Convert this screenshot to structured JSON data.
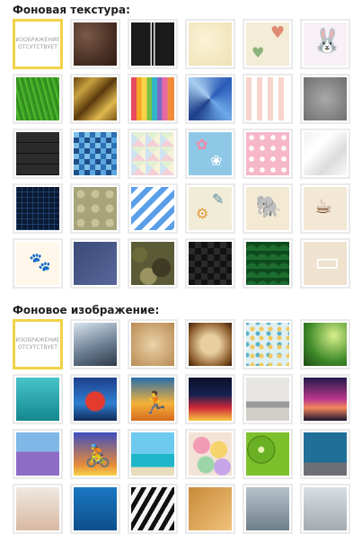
{
  "texture_section": {
    "title": "Фоновая текстура:",
    "tiles": [
      {
        "name": "no-image",
        "placeholder": "ИЗОБРАЖЕНИЕ ОТСУТСТВУЕТ",
        "selected": true
      },
      {
        "name": "leather-brown"
      },
      {
        "name": "black-road"
      },
      {
        "name": "cream-paper"
      },
      {
        "name": "hearts-pattern"
      },
      {
        "name": "bunny"
      },
      {
        "name": "green-grass"
      },
      {
        "name": "gold-foil"
      },
      {
        "name": "rainbow-stripes"
      },
      {
        "name": "blue-triangles"
      },
      {
        "name": "pink-stripes"
      },
      {
        "name": "gray-concrete"
      },
      {
        "name": "black-planks"
      },
      {
        "name": "blue-mosaic"
      },
      {
        "name": "pastel-rhombs"
      },
      {
        "name": "blue-doodles"
      },
      {
        "name": "pink-polka"
      },
      {
        "name": "white-crumpled"
      },
      {
        "name": "dark-blue-plaid"
      },
      {
        "name": "olive-dots"
      },
      {
        "name": "blue-diagonal-stripes"
      },
      {
        "name": "tools-pattern"
      },
      {
        "name": "elephants-pattern"
      },
      {
        "name": "kitchen-pattern"
      },
      {
        "name": "paw-tiles"
      },
      {
        "name": "denim-patch"
      },
      {
        "name": "camouflage"
      },
      {
        "name": "black-weave"
      },
      {
        "name": "green-scales"
      },
      {
        "name": "beige-furniture"
      }
    ]
  },
  "image_section": {
    "title": "Фоновое изображение:",
    "tiles": [
      {
        "name": "no-image",
        "placeholder": "ИЗОБРАЖЕНИЕ ОТСУТСТВУЕТ",
        "selected": true
      },
      {
        "name": "skyscraper"
      },
      {
        "name": "old-paper"
      },
      {
        "name": "burnt-parchment"
      },
      {
        "name": "confetti"
      },
      {
        "name": "christmas-tree"
      },
      {
        "name": "turquoise-water"
      },
      {
        "name": "race-car"
      },
      {
        "name": "runners-sunset"
      },
      {
        "name": "city-light-trails"
      },
      {
        "name": "living-room"
      },
      {
        "name": "purple-sunset-coast"
      },
      {
        "name": "lavender-field"
      },
      {
        "name": "cyclist-silhouette"
      },
      {
        "name": "tropical-sea"
      },
      {
        "name": "macarons"
      },
      {
        "name": "kiwi-slices"
      },
      {
        "name": "blue-wall-wood"
      },
      {
        "name": "portrait"
      },
      {
        "name": "ocean-wave"
      },
      {
        "name": "zebra"
      },
      {
        "name": "gold-hands"
      },
      {
        "name": "gray-sea"
      },
      {
        "name": "street-lamp"
      }
    ]
  }
}
